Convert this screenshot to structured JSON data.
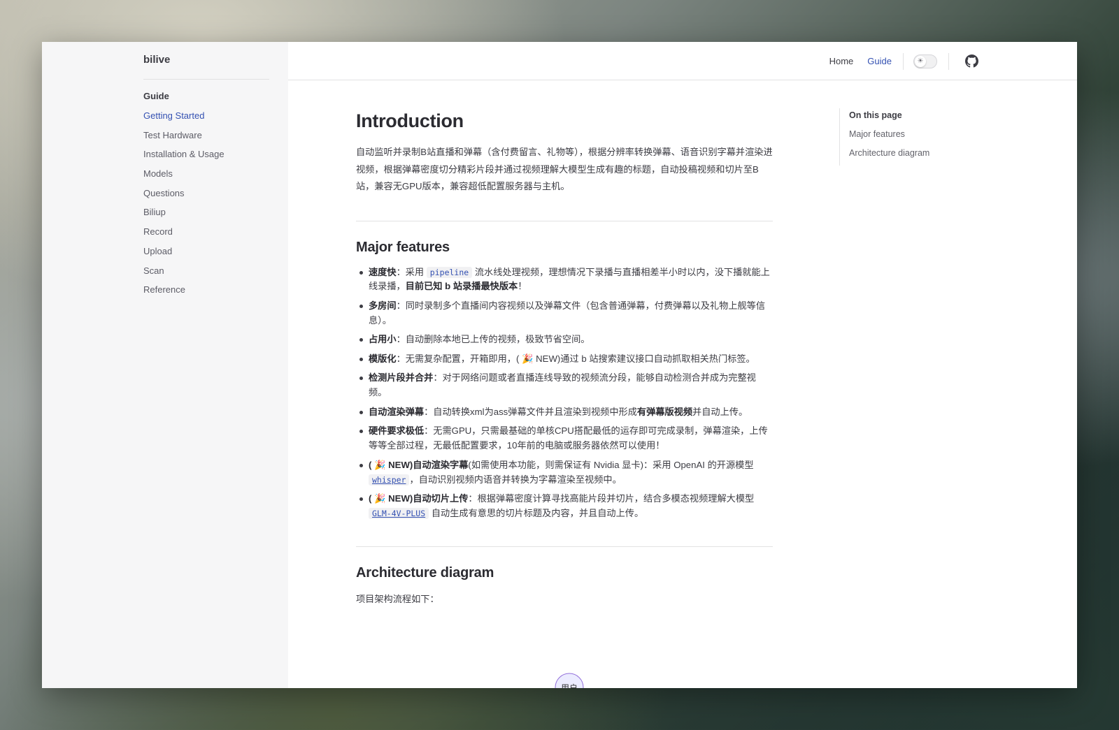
{
  "app": {
    "brand": "bilive"
  },
  "topnav": {
    "items": [
      {
        "label": "Home",
        "active": false
      },
      {
        "label": "Guide",
        "active": true
      }
    ],
    "theme_switch_icon": "sun-icon",
    "github_icon": "github-icon"
  },
  "sidebar": {
    "group_title": "Guide",
    "items": [
      {
        "label": "Getting Started",
        "active": true
      },
      {
        "label": "Test Hardware"
      },
      {
        "label": "Installation & Usage"
      },
      {
        "label": "Models"
      },
      {
        "label": "Questions"
      },
      {
        "label": "Biliup"
      },
      {
        "label": "Record"
      },
      {
        "label": "Upload"
      },
      {
        "label": "Scan"
      },
      {
        "label": "Reference"
      }
    ]
  },
  "main": {
    "title": "Introduction",
    "intro": "自动监听并录制B站直播和弹幕（含付费留言、礼物等），根据分辨率转换弹幕、语音识别字幕并渲染进视频，根据弹幕密度切分精彩片段并通过视频理解大模型生成有趣的标题，自动投稿视频和切片至B站，兼容无GPU版本，兼容超低配置服务器与主机。",
    "features_title": "Major features",
    "features": [
      {
        "bold": "速度快",
        "p1": "：采用 ",
        "code": "pipeline",
        "p2": " 流水线处理视频，理想情况下录播与直播相差半小时以内，没下播就能上线录播，",
        "bold2": "目前已知 b 站录播最快版本",
        "p3": "！"
      },
      {
        "bold": "多房间",
        "p1": "：同时录制多个直播间内容视频以及弹幕文件（包含普通弹幕，付费弹幕以及礼物上舰等信息）。"
      },
      {
        "bold": "占用小",
        "p1": "：自动删除本地已上传的视频，极致节省空间。"
      },
      {
        "bold": "模版化",
        "p1": "：无需复杂配置，开箱即用，( 🎉 NEW)通过 b 站搜索建议接口自动抓取相关热门标签。"
      },
      {
        "bold": "检测片段并合并",
        "p1": "：对于网络问题或者直播连线导致的视频流分段，能够自动检测合并成为完整视频。"
      },
      {
        "bold": "自动渲染弹幕",
        "p1": "：自动转换xml为ass弹幕文件并且渲染到视频中形成",
        "bold2": "有弹幕版视频",
        "p2": "并自动上传。"
      },
      {
        "bold": "硬件要求极低",
        "p1": "：无需GPU，只需最基础的单核CPU搭配最低的运存即可完成录制，弹幕渲染，上传等等全部过程，无最低配置要求，10年前的电脑或服务器依然可以使用！"
      },
      {
        "bold": "( 🎉 NEW)自动渲染字幕",
        "p1": "(如需使用本功能，则需保证有 Nvidia 显卡)：采用 OpenAI 的开源模型 ",
        "code": "whisper",
        "p2": "，自动识别视频内语音并转换为字幕渲染至视频中。"
      },
      {
        "bold": "( 🎉 NEW)自动切片上传",
        "p1": "：根据弹幕密度计算寻找高能片段并切片，结合多模态视频理解大模型 ",
        "code": "GLM-4V-PLUS",
        "p2": " 自动生成有意思的切片标题及内容，并且自动上传。"
      }
    ],
    "arch_title": "Architecture diagram",
    "arch_text": "项目架构流程如下：",
    "diagram_node": "用户"
  },
  "aside": {
    "title": "On this page",
    "links": [
      "Major features",
      "Architecture diagram"
    ]
  }
}
